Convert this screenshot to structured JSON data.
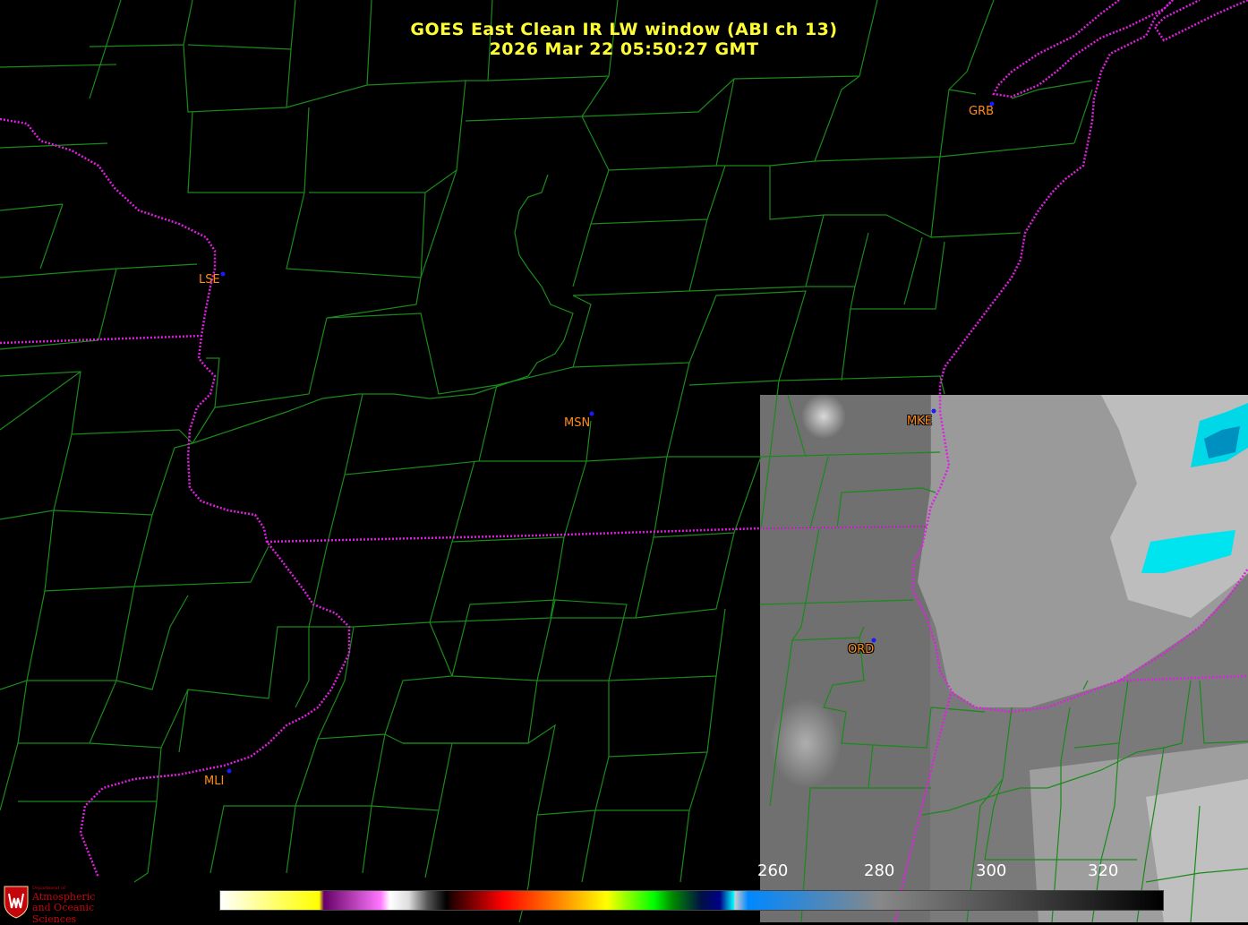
{
  "title": {
    "line1": "GOES East Clean IR LW window (ABI ch 13)",
    "line2": "2026 Mar 22  05:50:27 GMT"
  },
  "stations": [
    {
      "id": "GRB"
    },
    {
      "id": "LSE"
    },
    {
      "id": "MSN"
    },
    {
      "id": "MKE"
    },
    {
      "id": "ORD"
    },
    {
      "id": "MLI"
    }
  ],
  "colorbar": {
    "ticks": [
      "260",
      "280",
      "300",
      "320"
    ],
    "colors": [
      "#ffffff",
      "#ffff55",
      "#ffff00",
      "#800080",
      "#ff80ff",
      "#ffffff",
      "#888888",
      "#000000",
      "#ff0000",
      "#ff8800",
      "#ffff00",
      "#00ff00",
      "#008800",
      "#000088",
      "#00ffff",
      "#cccccc",
      "#000000"
    ]
  },
  "logo": {
    "line1": "Department of",
    "line2": "Atmospheric",
    "line3": "and Oceanic Sciences"
  },
  "colors": {
    "county_lines": "#1a8a1a",
    "state_lines": "#e020e0",
    "title": "#ffff33",
    "station_label": "#ff8c1a",
    "station_dot": "#1a1aff"
  }
}
